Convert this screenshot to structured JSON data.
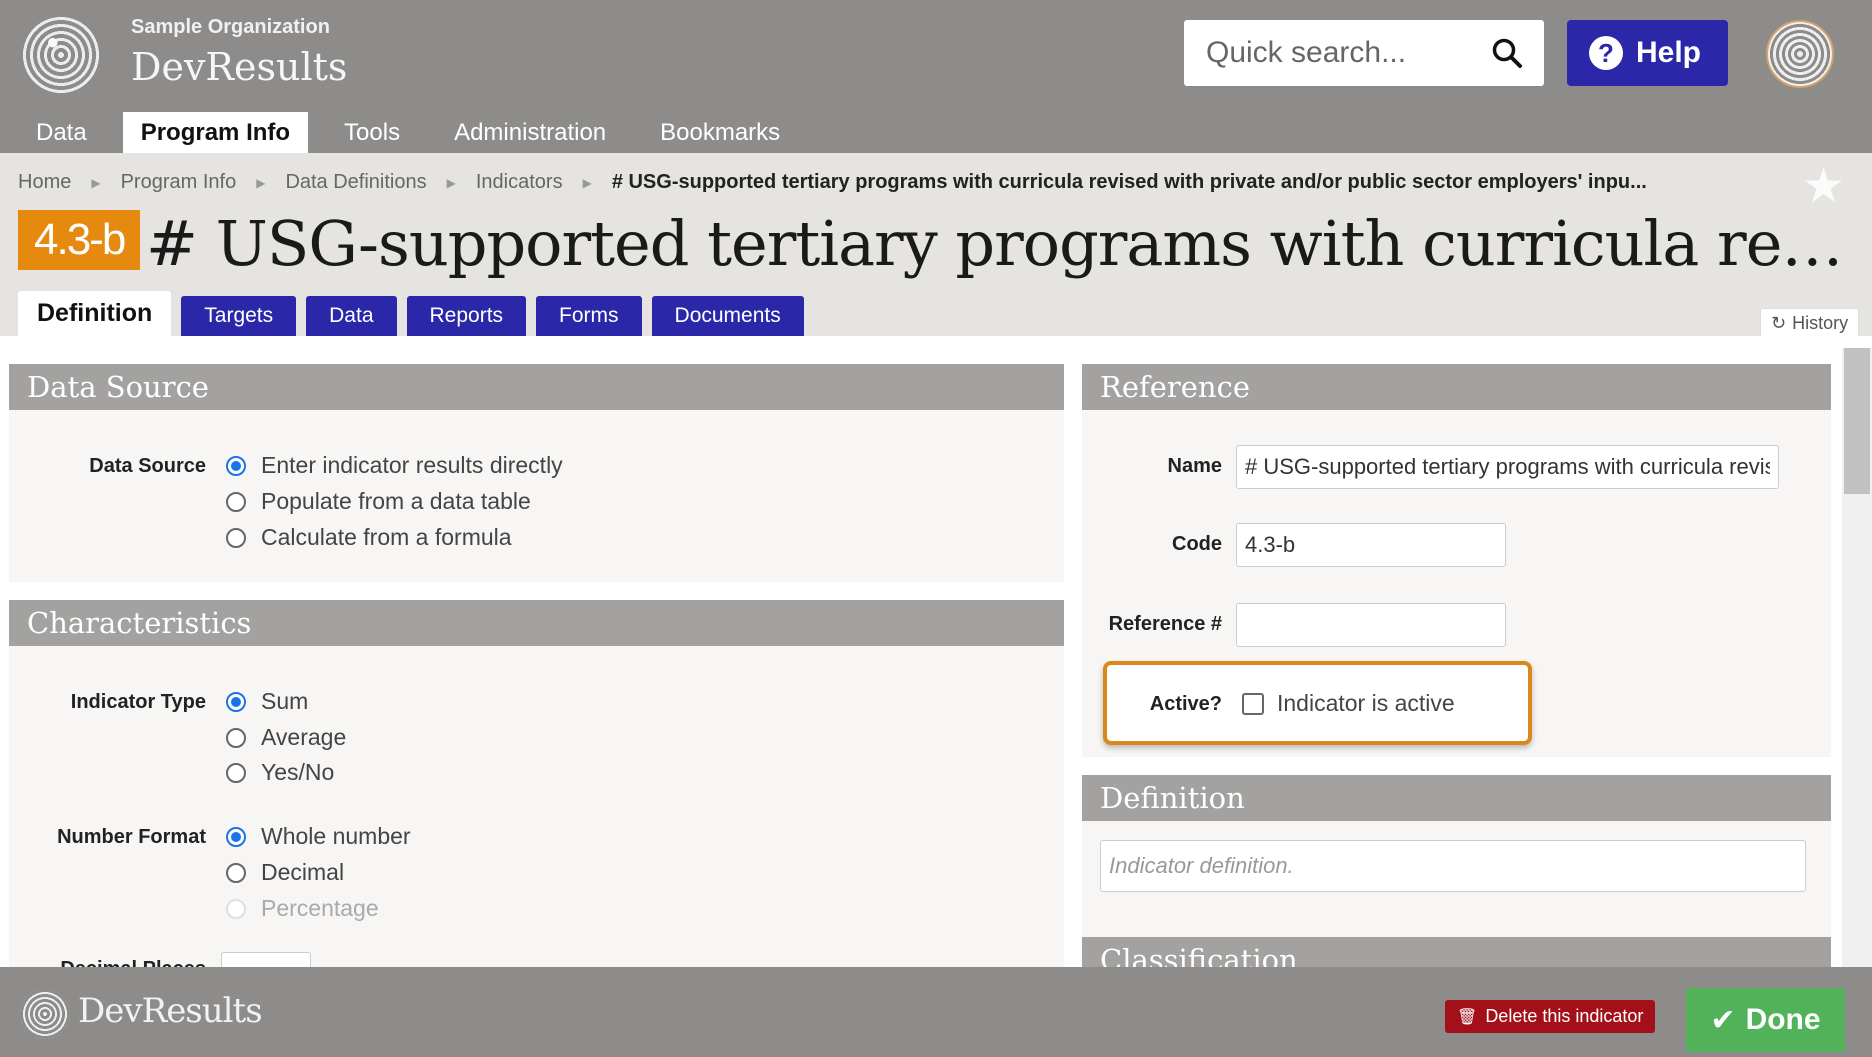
{
  "header": {
    "org_name": "Sample Organization",
    "app_name": "DevResults",
    "search_placeholder": "Quick search...",
    "help_label": "Help",
    "help_icon": "?"
  },
  "nav": {
    "items": [
      "Data",
      "Program Info",
      "Tools",
      "Administration",
      "Bookmarks"
    ],
    "active": "Program Info"
  },
  "breadcrumb": {
    "items": [
      "Home",
      "Program Info",
      "Data Definitions",
      "Indicators"
    ],
    "current": "# USG-supported tertiary programs with curricula revised with private and/or public sector employers' inpu..."
  },
  "indicator": {
    "code": "4.3-b",
    "title": "# USG-supported tertiary programs with curricula revised with private and/or public sector employers' input"
  },
  "tabs": {
    "active": "Definition",
    "items": [
      "Targets",
      "Data",
      "Reports",
      "Forms",
      "Documents"
    ],
    "history_label": "History"
  },
  "data_source": {
    "header": "Data Source",
    "label": "Data Source",
    "options": [
      "Enter indicator results directly",
      "Populate from a data table",
      "Calculate from a formula"
    ],
    "selected": 0
  },
  "characteristics": {
    "header": "Characteristics",
    "indicator_type_label": "Indicator Type",
    "indicator_type_options": [
      "Sum",
      "Average",
      "Yes/No"
    ],
    "number_format_label": "Number Format",
    "number_format_options": [
      "Whole number",
      "Decimal",
      "Percentage"
    ],
    "decimal_places_label": "Decimal Places"
  },
  "reference": {
    "header": "Reference",
    "name_label": "Name",
    "name_value": "# USG-supported tertiary programs with curricula revised with private and/or public sector employers' input",
    "code_label": "Code",
    "code_value": "4.3-b",
    "reference_label": "Reference #",
    "reference_value": "",
    "active_label": "Active?",
    "active_checkbox_label": "Indicator is active"
  },
  "definition": {
    "header": "Definition",
    "placeholder": "Indicator definition."
  },
  "classification": {
    "header": "Classification"
  },
  "footer": {
    "brand": "DevResults",
    "delete_label": "Delete this indicator",
    "done_label": "Done"
  },
  "colors": {
    "nav_bg": "#8d8c8b",
    "brand_blue": "#2a27a8",
    "badge_orange": "#e68a0f",
    "highlight": "#d9881c",
    "done_green": "#52b25a",
    "delete_red": "#a3101a"
  }
}
